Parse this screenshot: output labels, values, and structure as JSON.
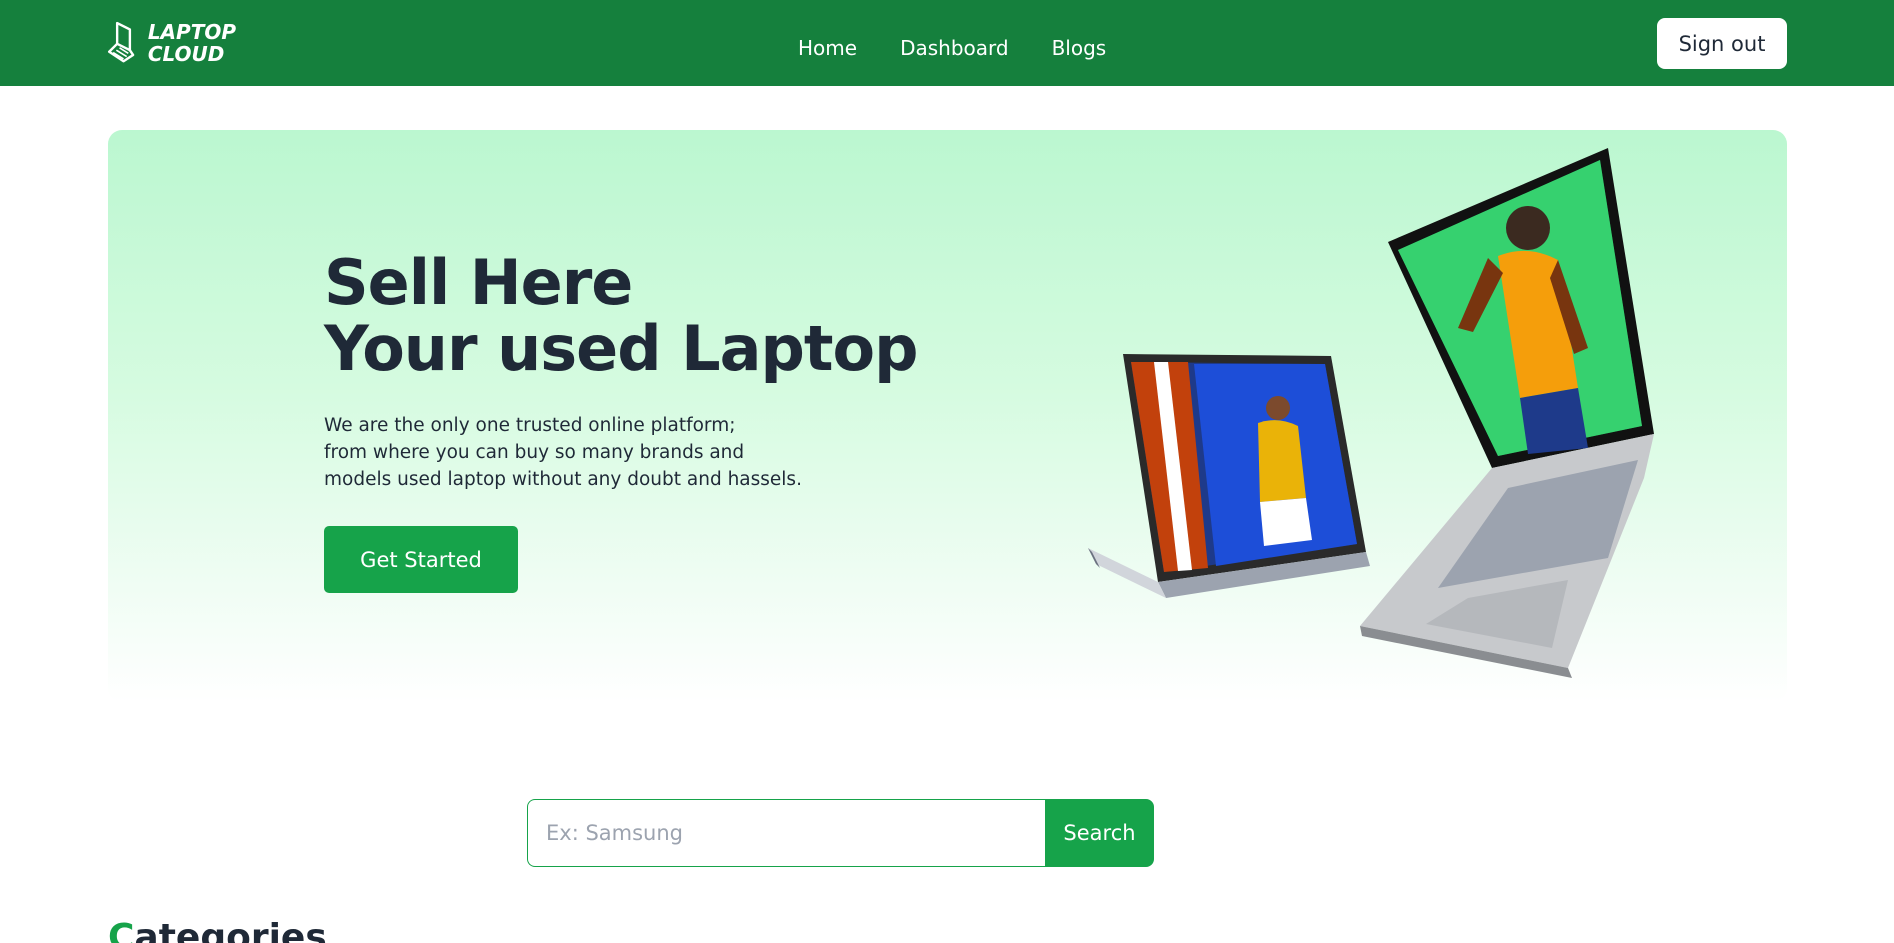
{
  "brand": {
    "line1": "LAPTOP",
    "line2": "CLOUD"
  },
  "nav": {
    "items": [
      {
        "label": "Home"
      },
      {
        "label": "Dashboard"
      },
      {
        "label": "Blogs"
      }
    ]
  },
  "header": {
    "signout_label": "Sign out"
  },
  "hero": {
    "title_line1": "Sell Here",
    "title_line2": "Your used Laptop",
    "desc_line1": "We are the only one trusted online platform;",
    "desc_line2": "from where you can buy so many brands and",
    "desc_line3": "models used laptop without any doubt and hassels.",
    "cta_label": "Get Started"
  },
  "search": {
    "placeholder": "Ex: Samsung",
    "value": "",
    "button_label": "Search"
  },
  "categories": {
    "title_first": "C",
    "title_rest": "ategories"
  },
  "colors": {
    "nav_bg": "#15803d",
    "accent": "#16a34a",
    "hero_bg": "#bbf7d0",
    "text": "#1f2937"
  },
  "icons": {
    "logo": "laptop-logo-icon"
  }
}
